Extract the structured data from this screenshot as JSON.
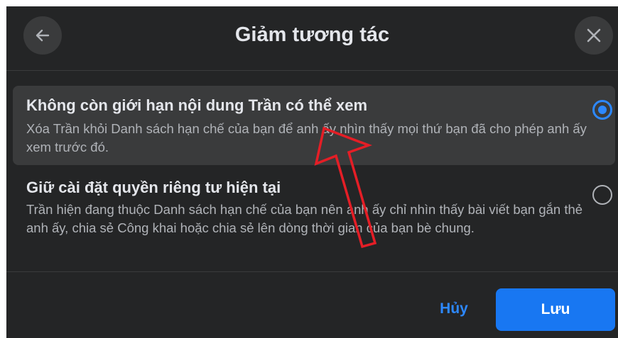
{
  "dialog": {
    "title": "Giảm tương tác",
    "back_icon": "arrow-left-icon",
    "close_icon": "close-icon"
  },
  "options": [
    {
      "title": "Không còn giới hạn nội dung Trần có thể xem",
      "description": "Xóa Trần khỏi Danh sách hạn chế của bạn để anh ấy nhìn thấy mọi thứ bạn đã cho phép anh ấy xem trước đó.",
      "selected": true
    },
    {
      "title": "Giữ cài đặt quyền riêng tư hiện tại",
      "description": "Trần hiện đang thuộc Danh sách hạn chế của bạn nên anh ấy chỉ nhìn thấy bài viết bạn gắn thẻ anh ấy, chia sẻ Công khai hoặc chia sẻ lên dòng thời gian của bạn bè chung.",
      "selected": false
    }
  ],
  "footer": {
    "cancel_label": "Hủy",
    "save_label": "Lưu"
  },
  "colors": {
    "background": "#242526",
    "surface": "#3a3b3c",
    "accent": "#2d88ff",
    "primary_button": "#1877f2",
    "annotation_arrow": "#e41e26"
  }
}
